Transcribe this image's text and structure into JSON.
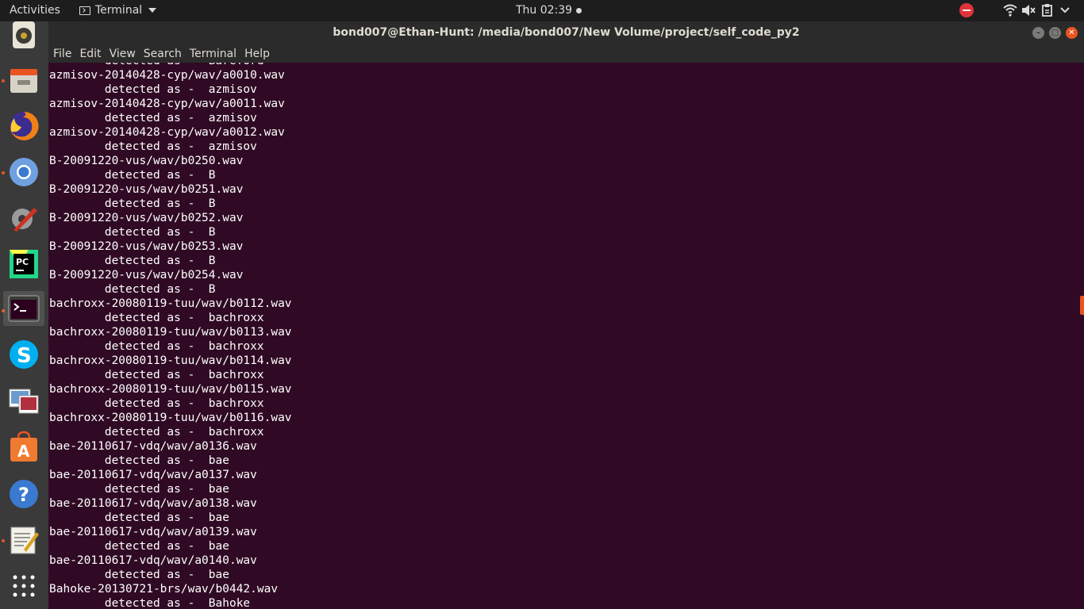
{
  "topbar": {
    "activities": "Activities",
    "app_name": "Terminal",
    "clock": "Thu 02:39",
    "tray_icons": [
      "stop-icon",
      "wifi-icon",
      "volume-muted-icon",
      "clipboard-icon",
      "chevron-down-icon"
    ]
  },
  "launcher": {
    "apps": [
      {
        "name": "rhythmbox",
        "running": false
      },
      {
        "name": "files",
        "running": true
      },
      {
        "name": "firefox",
        "running": false
      },
      {
        "name": "chromium",
        "running": true
      },
      {
        "name": "system-tools",
        "running": false
      },
      {
        "name": "pycharm",
        "running": false
      },
      {
        "name": "terminal",
        "running": true,
        "active": true
      },
      {
        "name": "skype",
        "running": false
      },
      {
        "name": "image-viewer",
        "running": false
      },
      {
        "name": "software-center",
        "running": false
      },
      {
        "name": "help",
        "running": false
      },
      {
        "name": "text-editor",
        "running": true
      },
      {
        "name": "show-applications",
        "running": false
      }
    ]
  },
  "window": {
    "title": "bond007@Ethan-Hunt: /media/bond007/New Volume/project/self_code_py2",
    "buttons": {
      "minimize": "–",
      "maximize": "□",
      "close": "✕"
    }
  },
  "menu": {
    "file": "File",
    "edit": "Edit",
    "view": "View",
    "search": "Search",
    "terminal": "Terminal",
    "help": "Help"
  },
  "terminal": {
    "lines": [
      "        detected as -  Bareford",
      "azmisov-20140428-cyp/wav/a0010.wav",
      "        detected as -  azmisov",
      "azmisov-20140428-cyp/wav/a0011.wav",
      "        detected as -  azmisov",
      "azmisov-20140428-cyp/wav/a0012.wav",
      "        detected as -  azmisov",
      "B-20091220-vus/wav/b0250.wav",
      "        detected as -  B",
      "B-20091220-vus/wav/b0251.wav",
      "        detected as -  B",
      "B-20091220-vus/wav/b0252.wav",
      "        detected as -  B",
      "B-20091220-vus/wav/b0253.wav",
      "        detected as -  B",
      "B-20091220-vus/wav/b0254.wav",
      "        detected as -  B",
      "bachroxx-20080119-tuu/wav/b0112.wav",
      "        detected as -  bachroxx",
      "bachroxx-20080119-tuu/wav/b0113.wav",
      "        detected as -  bachroxx",
      "bachroxx-20080119-tuu/wav/b0114.wav",
      "        detected as -  bachroxx",
      "bachroxx-20080119-tuu/wav/b0115.wav",
      "        detected as -  bachroxx",
      "bachroxx-20080119-tuu/wav/b0116.wav",
      "        detected as -  bachroxx",
      "bae-20110617-vdq/wav/a0136.wav",
      "        detected as -  bae",
      "bae-20110617-vdq/wav/a0137.wav",
      "        detected as -  bae",
      "bae-20110617-vdq/wav/a0138.wav",
      "        detected as -  bae",
      "bae-20110617-vdq/wav/a0139.wav",
      "        detected as -  bae",
      "bae-20110617-vdq/wav/a0140.wav",
      "        detected as -  bae",
      "Bahoke-20130721-brs/wav/b0442.wav",
      "        detected as -  Bahoke"
    ]
  },
  "colors": {
    "terminal_bg": "#300a24",
    "topbar_bg": "#1d1d1d",
    "launcher_bg": "#3a3a3a",
    "titlebar_bg": "#2b2b2b",
    "accent": "#e95420"
  }
}
